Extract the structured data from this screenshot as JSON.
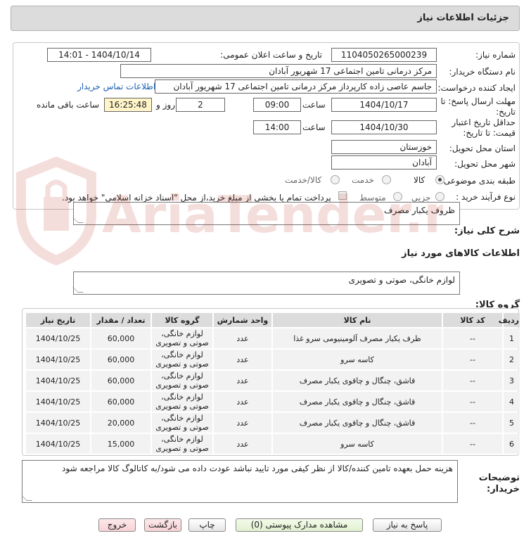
{
  "header": {
    "title": "جزئیات اطلاعات نیاز"
  },
  "form": {
    "need_number_label": "شماره نیاز:",
    "need_number": "1104050265000239",
    "announce_label": "تاریخ و ساعت اعلان عمومی:",
    "announce_value": "1404/10/14 - 14:01",
    "buyer_label": "نام دستگاه خریدار:",
    "buyer_value": "مرکز درمانی تامین اجتماعی 17 شهریور آبادان",
    "creator_label": "ایجاد کننده درخواست:",
    "creator_value": "جاسم عاصی زاده کارپرداز مرکز درمانی تامین اجتماعی 17 شهریور آبادان",
    "contact_link": "اطلاعات تماس خریدار",
    "deadline_label_1": "مهلت ارسال پاسخ: تا",
    "deadline_label_2": "تاریخ:",
    "deadline_date": "1404/10/17",
    "time_label": "ساعت",
    "deadline_time": "09:00",
    "days_value": "2",
    "days_label": "روز و",
    "remaining_time": "16:25:48",
    "remaining_label": "ساعت باقی مانده",
    "validity_label_1": "حداقل تاریخ اعتبار",
    "validity_label_2": "قیمت: تا تاریخ:",
    "validity_date": "1404/10/30",
    "validity_time": "14:00",
    "province_label": "استان محل تحویل:",
    "province_value": "خوزستان",
    "city_label": "شهر محل تحویل:",
    "city_value": "آبادان",
    "category_label": "طبقه بندی موضوعی:",
    "category_options": [
      "کالا",
      "خدمت",
      "کالا/خدمت"
    ],
    "category_selected": "کالا",
    "process_label": "نوع فرآیند خرید :",
    "process_options": [
      "جزیی",
      "متوسط"
    ],
    "payment_note": "پرداخت تمام یا بخشی از مبلغ خرید،از محل \"اسناد خزانه اسلامی\" خواهد بود."
  },
  "description": {
    "label": "شرح کلی نیاز:",
    "value": "ظروف یکبار مصرف"
  },
  "goods_info_title": "اطلاعات کالاهای مورد نیاز",
  "goods_group": {
    "label": "گروه کالا:",
    "value": "لوازم خانگی، صوتی و تصویری"
  },
  "table": {
    "headers": [
      "ردیف",
      "کد کالا",
      "نام کالا",
      "واحد شمارش",
      "گروه کالا",
      "تعداد / مقدار",
      "تاریخ نیاز"
    ],
    "rows": [
      [
        "1",
        "--",
        "ظرف یکبار مصرف آلومینیومی سرو غذا",
        "عدد",
        "لوازم خانگی، صوتی و تصویری",
        "60,000",
        "1404/10/25"
      ],
      [
        "2",
        "--",
        "کاسه سرو",
        "عدد",
        "لوازم خانگی، صوتی و تصویری",
        "60,000",
        "1404/10/25"
      ],
      [
        "3",
        "--",
        "قاشق، چنگال و چاقوی یکبار مصرف",
        "عدد",
        "لوازم خانگی، صوتی و تصویری",
        "60,000",
        "1404/10/25"
      ],
      [
        "4",
        "--",
        "قاشق، چنگال و چاقوی یکبار مصرف",
        "عدد",
        "لوازم خانگی، صوتی و تصویری",
        "60,000",
        "1404/10/25"
      ],
      [
        "5",
        "--",
        "قاشق، چنگال و چاقوی یکبار مصرف",
        "عدد",
        "لوازم خانگی، صوتی و تصویری",
        "20,000",
        "1404/10/25"
      ],
      [
        "6",
        "--",
        "کاسه سرو",
        "عدد",
        "لوازم خانگی، صوتی و تصویری",
        "15,000",
        "1404/10/25"
      ]
    ]
  },
  "buyer_notes": {
    "label_1": "توضیحات",
    "label_2": "خریدار:",
    "value": "هزینه حمل بعهده تامین کننده/کالا از نظر کیفی مورد تایید نباشد عودت داده می شود/به کاتالوگ کالا مراجعه شود"
  },
  "buttons": {
    "reply": "پاسخ به نیاز",
    "docs": "مشاهده مدارک پیوستی (0)",
    "print": "چاپ",
    "back": "بازگشت",
    "exit": "خروج"
  },
  "watermark": {
    "text": "AriaTender.neT"
  },
  "colors": {
    "header_bg": "#dcdcdc",
    "time_highlight": "#fff5c8",
    "link": "#1a5fb4",
    "watermark": "#c0392b"
  }
}
